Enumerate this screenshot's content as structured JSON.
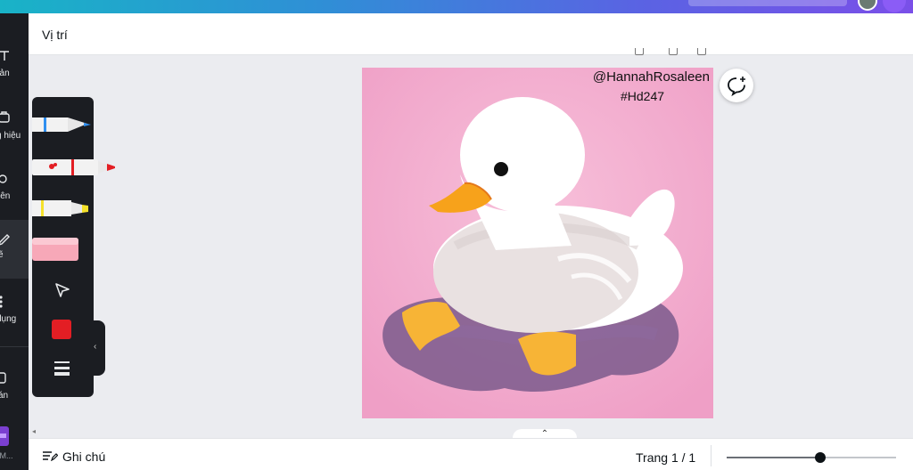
{
  "header": {
    "title": "Vị trí"
  },
  "sidebar": {
    "items": [
      {
        "label": "bản",
        "icon": "text-icon"
      },
      {
        "label": "g hiệu",
        "icon": "brand-icon"
      },
      {
        "label": "iên",
        "icon": "elements-icon"
      },
      {
        "label": "ẽ",
        "icon": "draw-icon"
      },
      {
        "label": "dụng",
        "icon": "apps-icon"
      },
      {
        "label": "án",
        "icon": "projects-icon"
      },
      {
        "label": "g M...",
        "icon": "magic-app-icon"
      }
    ]
  },
  "artwork": {
    "watermark_handle": "@HannahRosaleen",
    "watermark_tag": "#Hd247"
  },
  "draw_tools": {
    "pen_colors": {
      "pen": "#2f8ff0",
      "marker": "#e31e24",
      "highlighter": "#f5e12a",
      "eraser": "#f7a8b8"
    },
    "current_color": "#e31e24"
  },
  "bottom": {
    "notes_label": "Ghi chú",
    "page_indicator": "Trang 1 / 1",
    "zoom_fraction": 0.55
  },
  "colors": {
    "accent_gradient_start": "#19b3c7",
    "accent_gradient_end": "#7a4fe8",
    "artwork_bg": "#f2a9cd"
  }
}
